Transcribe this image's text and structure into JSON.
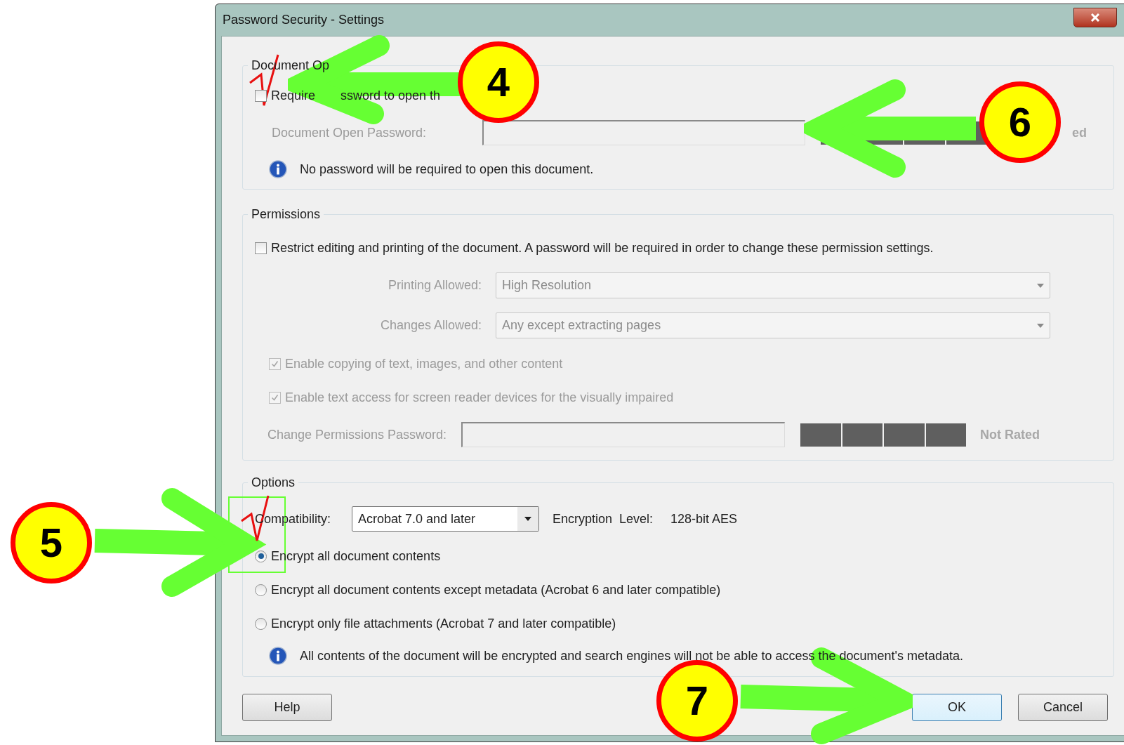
{
  "window": {
    "title": "Password Security - Settings"
  },
  "document_open": {
    "legend": "Document Op",
    "require": {
      "checked": false,
      "label_parts": [
        "Require",
        "ssword to open th"
      ]
    },
    "password_label": "Document Open Password:",
    "strength_text": "ed",
    "info": "No password will be required to open this document."
  },
  "permissions": {
    "legend": "Permissions",
    "restrict": {
      "checked": false,
      "label": "Restrict editing and printing of the document. A password will be required in order to change these permission settings."
    },
    "selects": [
      {
        "label": "Printing Allowed:",
        "value": "High Resolution",
        "disabled": true
      },
      {
        "label": "Changes Allowed:",
        "value": "Any except extracting pages",
        "disabled": true
      }
    ],
    "checkboxes": [
      {
        "label": "Enable copying of text, images, and other content",
        "checked": true,
        "disabled": true
      },
      {
        "label": "Enable text access for screen reader devices for the visually impaired",
        "checked": true,
        "disabled": true
      }
    ],
    "password_label": "Change Permissions Password:",
    "strength_text": "Not Rated"
  },
  "options": {
    "legend": "Options",
    "compatibility_label": "Compatibility:",
    "compatibility_value": "Acrobat 7.0 and later",
    "encryption_label": "Encryption  Level:",
    "encryption_value": "128-bit AES",
    "radios": [
      {
        "label": "Encrypt all document contents",
        "selected": true
      },
      {
        "label": "Encrypt all document contents except metadata (Acrobat 6 and later compatible)",
        "selected": false
      },
      {
        "label": "Encrypt only file attachments (Acrobat 7 and later compatible)",
        "selected": false
      }
    ],
    "info": "All contents of the document will be encrypted and search engines will not be able to access the document's metadata."
  },
  "buttons": [
    {
      "label": "Help",
      "default": false
    },
    {
      "label": "OK",
      "default": true
    },
    {
      "label": "Cancel",
      "default": false
    }
  ],
  "callouts": [
    {
      "number": "4"
    },
    {
      "number": "6"
    },
    {
      "number": "5"
    },
    {
      "number": "7"
    }
  ]
}
